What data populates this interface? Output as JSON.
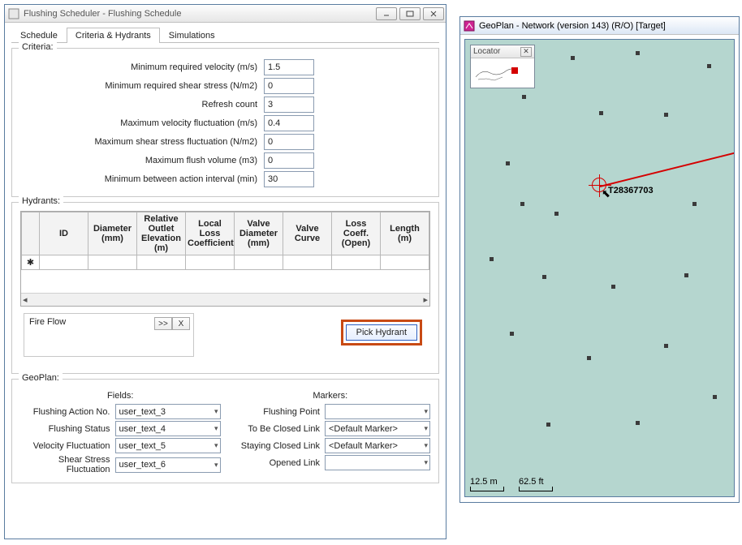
{
  "left_window": {
    "title": "Flushing Scheduler - Flushing Schedule",
    "tabs": {
      "schedule": "Schedule",
      "criteria": "Criteria & Hydrants",
      "simulations": "Simulations"
    },
    "criteria": {
      "legend": "Criteria:",
      "rows": {
        "min_velocity": {
          "label": "Minimum required velocity (m/s)",
          "value": "1.5"
        },
        "min_shear": {
          "label": "Minimum required shear stress (N/m2)",
          "value": "0"
        },
        "refresh": {
          "label": "Refresh count",
          "value": "3"
        },
        "max_vel_fluc": {
          "label": "Maximum velocity fluctuation (m/s)",
          "value": "0.4"
        },
        "max_shear_fluc": {
          "label": "Maximum shear stress fluctuation (N/m2)",
          "value": "0"
        },
        "max_flush_vol": {
          "label": "Maximum flush volume (m3)",
          "value": "0"
        },
        "min_interval": {
          "label": "Minimum between action interval (min)",
          "value": "30"
        }
      }
    },
    "hydrants": {
      "legend": "Hydrants:",
      "columns": {
        "id": "ID",
        "diameter": "Diameter (mm)",
        "rel_outlet": "Relative Outlet Elevation (m)",
        "local_loss": "Local Loss Coefficient",
        "valve_dia": "Valve Diameter (mm)",
        "valve_curve": "Valve Curve",
        "loss_coeff": "Loss Coeff. (Open)",
        "length": "Length (m)"
      },
      "row_marker": "✱",
      "fireflow": {
        "label": "Fire Flow",
        "btn_more": ">>",
        "btn_close": "X"
      },
      "pick_hydrant": "Pick Hydrant"
    },
    "geoplan": {
      "legend": "GeoPlan:",
      "fields_head": "Fields:",
      "markers_head": "Markers:",
      "fields": {
        "action_no": {
          "label": "Flushing Action No.",
          "value": "user_text_3"
        },
        "status": {
          "label": "Flushing Status",
          "value": "user_text_4"
        },
        "vel_fluc": {
          "label": "Velocity Fluctuation",
          "value": "user_text_5"
        },
        "shear_fluc": {
          "label": "Shear Stress Fluctuation",
          "value": "user_text_6"
        }
      },
      "markers": {
        "flushing_point": {
          "label": "Flushing Point",
          "value": ""
        },
        "to_be_closed": {
          "label": "To Be Closed Link",
          "value": "<Default Marker>"
        },
        "staying_closed": {
          "label": "Staying Closed Link",
          "value": "<Default Marker>"
        },
        "opened": {
          "label": "Opened Link",
          "value": ""
        }
      }
    }
  },
  "right_window": {
    "title": "GeoPlan - Network (version 143) (R/O) [Target]",
    "locator_title": "Locator",
    "node_label": "T28367703",
    "scale": {
      "metric": "12.5 m",
      "imperial": "62.5 ft"
    }
  }
}
